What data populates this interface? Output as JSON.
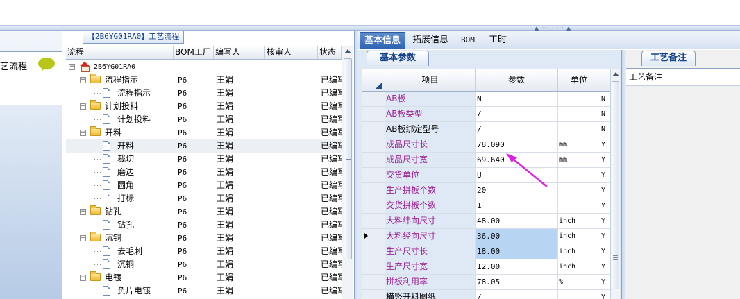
{
  "colors": {
    "accent": "#2c63b1",
    "item_text": "#9b2294",
    "highlight": "#b7d4f3",
    "annotation_arrow": "#e020e0"
  },
  "left_panel": {
    "label": "艺流程",
    "icon": "speech-bubble-icon"
  },
  "process_panel": {
    "title": "【2B6YG01RA0】工艺流程",
    "columns": [
      "流程",
      "BOM工厂",
      "编写人",
      "核审人",
      "状态"
    ],
    "rows": [
      {
        "level": 0,
        "type": "root",
        "name": "2B6YG01RA0",
        "factory": "",
        "writer": "",
        "reviewer": "",
        "status": ""
      },
      {
        "level": 1,
        "type": "folder",
        "name": "流程指示",
        "factory": "P6",
        "writer": "王娟",
        "reviewer": "",
        "status": "已编写"
      },
      {
        "level": 2,
        "type": "doc",
        "name": "流程指示",
        "factory": "P6",
        "writer": "王娟",
        "reviewer": "",
        "status": "已编写"
      },
      {
        "level": 1,
        "type": "folder",
        "name": "计划投料",
        "factory": "P6",
        "writer": "王娟",
        "reviewer": "",
        "status": "已编写"
      },
      {
        "level": 2,
        "type": "doc",
        "name": "计划投料",
        "factory": "P6",
        "writer": "王娟",
        "reviewer": "",
        "status": "已编写"
      },
      {
        "level": 1,
        "type": "folder",
        "name": "开料",
        "factory": "P6",
        "writer": "王娟",
        "reviewer": "",
        "status": "已编写"
      },
      {
        "level": 2,
        "type": "doc",
        "name": "开料",
        "factory": "P6",
        "writer": "王娟",
        "reviewer": "",
        "status": "已编写",
        "selected": true
      },
      {
        "level": 2,
        "type": "doc",
        "name": "裁切",
        "factory": "P6",
        "writer": "王娟",
        "reviewer": "",
        "status": "已编写"
      },
      {
        "level": 2,
        "type": "doc",
        "name": "磨边",
        "factory": "P6",
        "writer": "王娟",
        "reviewer": "",
        "status": "已编写"
      },
      {
        "level": 2,
        "type": "doc",
        "name": "圆角",
        "factory": "P6",
        "writer": "王娟",
        "reviewer": "",
        "status": "已编写"
      },
      {
        "level": 2,
        "type": "doc",
        "name": "打标",
        "factory": "P6",
        "writer": "王娟",
        "reviewer": "",
        "status": "已编写"
      },
      {
        "level": 1,
        "type": "folder",
        "name": "钻孔",
        "factory": "P6",
        "writer": "王娟",
        "reviewer": "",
        "status": "已编写"
      },
      {
        "level": 2,
        "type": "doc",
        "name": "钻孔",
        "factory": "P6",
        "writer": "王娟",
        "reviewer": "",
        "status": "已编写"
      },
      {
        "level": 1,
        "type": "folder",
        "name": "沉铜",
        "factory": "P6",
        "writer": "王娟",
        "reviewer": "",
        "status": "已编写"
      },
      {
        "level": 2,
        "type": "doc",
        "name": "去毛刺",
        "factory": "P6",
        "writer": "王娟",
        "reviewer": "",
        "status": "已编写"
      },
      {
        "level": 2,
        "type": "doc",
        "name": "沉铜",
        "factory": "P6",
        "writer": "王娟",
        "reviewer": "",
        "status": "已编写"
      },
      {
        "level": 1,
        "type": "folder",
        "name": "电镀",
        "factory": "P6",
        "writer": "王娟",
        "reviewer": "",
        "status": "已编写"
      },
      {
        "level": 2,
        "type": "doc",
        "name": "负片电镀",
        "factory": "P6",
        "writer": "王娟",
        "reviewer": "",
        "status": "已编写"
      }
    ]
  },
  "tabs": [
    {
      "label": "基本信息",
      "active": true
    },
    {
      "label": "拓展信息",
      "active": false
    },
    {
      "label": "BOM",
      "active": false
    },
    {
      "label": "工时",
      "active": false
    }
  ],
  "basic_params": {
    "tab_label": "基本参数",
    "columns": [
      "项目",
      "参数",
      "单位"
    ],
    "rows": [
      {
        "item": "AB板",
        "value": "N",
        "unit": "",
        "flag": "N",
        "color": "purple"
      },
      {
        "item": "AB板类型",
        "value": "/",
        "unit": "",
        "flag": "N",
        "color": "purple"
      },
      {
        "item": "AB板绑定型号",
        "value": "/",
        "unit": "",
        "flag": "N",
        "color": "black"
      },
      {
        "item": "成品尺寸长",
        "value": "78.090",
        "unit": "mm",
        "flag": "Y",
        "color": "purple"
      },
      {
        "item": "成品尺寸宽",
        "value": "69.640",
        "unit": "mm",
        "flag": "Y",
        "color": "purple"
      },
      {
        "item": "交货单位",
        "value": "U",
        "unit": "",
        "flag": "Y",
        "color": "purple"
      },
      {
        "item": "生产拼板个数",
        "value": "20",
        "unit": "",
        "flag": "Y",
        "color": "purple"
      },
      {
        "item": "交货拼板个数",
        "value": "1",
        "unit": "",
        "flag": "Y",
        "color": "purple"
      },
      {
        "item": "大料纬向尺寸",
        "value": "48.00",
        "unit": "inch",
        "flag": "Y",
        "color": "purple"
      },
      {
        "item": "大料经向尺寸",
        "value": "36.00",
        "unit": "inch",
        "flag": "Y",
        "color": "purple",
        "current": true,
        "highlight": true
      },
      {
        "item": "生产尺寸长",
        "value": "18.00",
        "unit": "inch",
        "flag": "Y",
        "color": "purple",
        "highlight": true
      },
      {
        "item": "生产尺寸宽",
        "value": "12.00",
        "unit": "inch",
        "flag": "Y",
        "color": "purple"
      },
      {
        "item": "拼板利用率",
        "value": "78.05",
        "unit": "%",
        "flag": "Y",
        "color": "purple"
      },
      {
        "item": "横竖开料图纸",
        "value": "/",
        "unit": "",
        "flag": "Y",
        "color": "black"
      }
    ]
  },
  "notes": {
    "tab_label": "工艺备注",
    "header": "工艺备注"
  }
}
